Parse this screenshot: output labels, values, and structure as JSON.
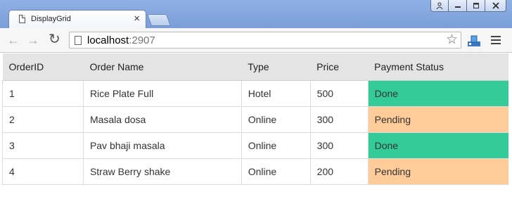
{
  "browser": {
    "tab_title": "DisplayGrid",
    "tab_close": "×",
    "url_host": "localhost",
    "url_port": ":2907"
  },
  "icons": {
    "back": "back-arrow-icon",
    "forward": "forward-arrow-icon",
    "reload": "reload-icon",
    "star": "star-icon",
    "menu": "hamburger-menu-icon"
  },
  "grid": {
    "columns": [
      "OrderID",
      "Order Name",
      "Type",
      "Price",
      "Payment Status"
    ],
    "rows": [
      {
        "id": "1",
        "name": "Rice Plate Full",
        "type": "Hotel",
        "price": "500",
        "status": "Done"
      },
      {
        "id": "2",
        "name": "Masala dosa",
        "type": "Online",
        "price": "300",
        "status": "Pending"
      },
      {
        "id": "3",
        "name": "Pav bhaji masala",
        "type": "Online",
        "price": "300",
        "status": "Done"
      },
      {
        "id": "4",
        "name": "Straw Berry shake",
        "type": "Online",
        "price": "200",
        "status": "Pending"
      }
    ],
    "status_colors": {
      "Done": "#33cc99",
      "Pending": "#ffcc99"
    }
  }
}
